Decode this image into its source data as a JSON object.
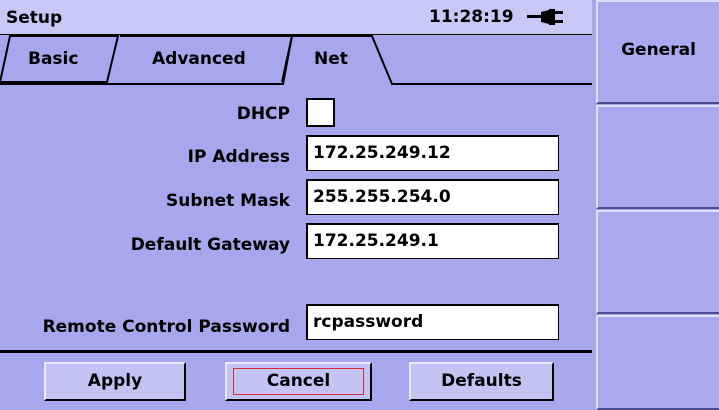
{
  "header": {
    "title": "Setup",
    "time": "11:28:19"
  },
  "tabs": [
    {
      "label": "Basic",
      "active": false
    },
    {
      "label": "Advanced",
      "active": false
    },
    {
      "label": "Net",
      "active": true
    }
  ],
  "form": {
    "dhcp_label": "DHCP",
    "dhcp_checked": false,
    "ip_label": "IP Address",
    "ip_value": "172.25.249.12",
    "subnet_label": "Subnet Mask",
    "subnet_value": "255.255.254.0",
    "gateway_label": "Default Gateway",
    "gateway_value": "172.25.249.1",
    "password_label": "Remote Control Password",
    "password_value": "rcpassword"
  },
  "buttons": {
    "apply": "Apply",
    "cancel": "Cancel",
    "defaults": "Defaults",
    "focused": "Cancel"
  },
  "softkeys": [
    "General",
    "",
    "",
    ""
  ],
  "colors": {
    "background": "#a7a7ed",
    "title_bar": "#c8c8f6",
    "focus_outline": "#d03030"
  },
  "icons": {
    "power": "plug-icon"
  }
}
